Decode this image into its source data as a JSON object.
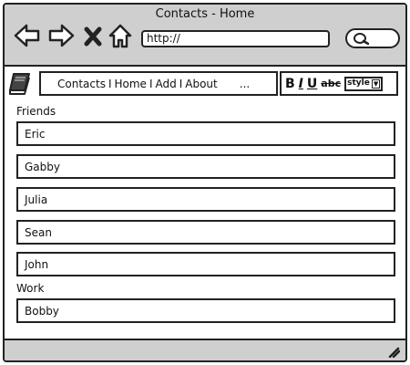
{
  "window": {
    "title": "Contacts - Home"
  },
  "toolbar": {
    "back_icon": "arrow-left-icon",
    "forward_icon": "arrow-right-icon",
    "stop_icon": "close-icon",
    "home_icon": "home-icon",
    "url": "http://",
    "search_icon": "search-icon"
  },
  "menu": {
    "items": [
      "Contacts",
      "Home",
      "Add",
      "About"
    ],
    "separator": "I",
    "more": "..."
  },
  "format": {
    "bold": "B",
    "italic": "I",
    "underline": "U",
    "strike": "abc",
    "style": "style"
  },
  "groups": {
    "friends": {
      "label": "Friends",
      "contacts": [
        "Eric",
        "Gabby",
        "Julia",
        "Sean",
        "John"
      ]
    },
    "work": {
      "label": "Work",
      "contacts": [
        "Bobby"
      ]
    }
  },
  "colors": {
    "chrome": "#cfcfcf",
    "border": "#222222",
    "background": "#ffffff"
  }
}
